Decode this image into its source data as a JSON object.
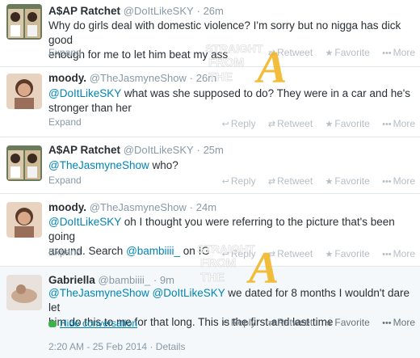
{
  "tweets": [
    {
      "name": "A$AP Ratchet",
      "handle": "@DoItLikeSKY",
      "time": "26m",
      "text_lines": [
        "Why do girls deal with domestic violence? I'm sorry but no nigga has dick good",
        "enough for me to let him beat my ass"
      ],
      "footer": "Expand",
      "actions": {
        "reply": "Reply",
        "retweet": "Retweet",
        "favorite": "Favorite",
        "more": "More"
      }
    },
    {
      "name": "moody.",
      "handle": "@TheJasmyneShow",
      "time": "26m",
      "mention": "@DoItLikeSKY",
      "text_lines": [
        " what was she supposed to do? They were in a car and he's",
        "stronger than her"
      ],
      "footer": "Expand",
      "actions": {
        "reply": "Reply",
        "retweet": "Retweet",
        "favorite": "Favorite",
        "more": "More"
      }
    },
    {
      "name": "A$AP Ratchet",
      "handle": "@DoItLikeSKY",
      "time": "25m",
      "mention": "@TheJasmyneShow",
      "text_lines": [
        " who?"
      ],
      "footer": "Expand",
      "actions": {
        "reply": "Reply",
        "retweet": "Retweet",
        "favorite": "Favorite",
        "more": "More"
      }
    },
    {
      "name": "moody.",
      "handle": "@TheJasmyneShow",
      "time": "24m",
      "mention": "@DoItLikeSKY",
      "text_lines": [
        " oh I thought you were referring to the picture that's been going",
        "around. Search ",
        " on IG"
      ],
      "mention2": "@bambiiii_",
      "footer": "Expand",
      "actions": {
        "reply": "Reply",
        "retweet": "Retweet",
        "favorite": "Favorite",
        "more": "More"
      }
    },
    {
      "name": "Gabriella",
      "handle": "@bambiiii_",
      "time": "9m",
      "mention": "@TheJasmyneShow",
      "mention2": "@DoItLikeSKY",
      "text_lines": [
        " we dated for 8 months I wouldn't dare let",
        "him do this to me for that long. This is the first and last time"
      ],
      "footer": "Hide conversation",
      "actions": {
        "reply": "Reply",
        "retweet": "Retweet",
        "favorite": "Favorite",
        "more": "More"
      }
    }
  ],
  "timestamp": "2:20 AM - 25 Feb 2014",
  "details_link": "Details",
  "separator": "·",
  "watermark": {
    "line1": "STRAIGHT",
    "line2": "FROM",
    "line3": "THE",
    "letter": "A"
  },
  "colors": {
    "link": "#0084b4",
    "name": "#292f33",
    "meta": "#8899a6",
    "accent_a": "#f2b21a"
  },
  "icons": [
    "reply-icon",
    "retweet-icon",
    "favorite-icon",
    "more-icon",
    "conversation-icon"
  ]
}
